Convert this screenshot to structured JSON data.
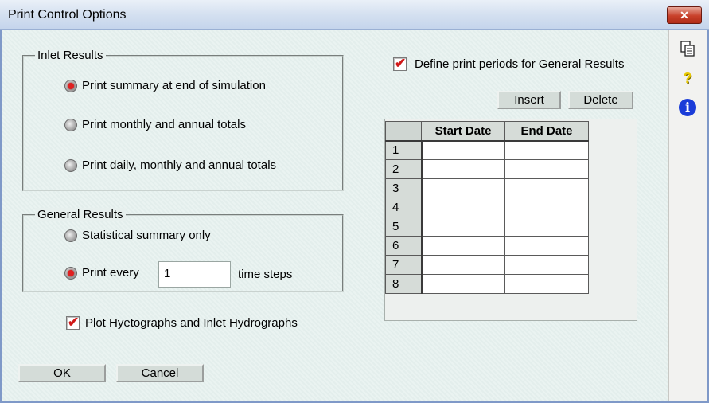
{
  "window": {
    "title": "Print Control Options",
    "close_label": "✕"
  },
  "inlet_results": {
    "title": "Inlet Results",
    "options": [
      {
        "label": "Print summary at end of simulation",
        "selected": true
      },
      {
        "label": "Print monthly and annual totals",
        "selected": false
      },
      {
        "label": "Print daily, monthly and annual totals",
        "selected": false
      }
    ]
  },
  "general_results": {
    "title": "General Results",
    "statistical_label": "Statistical summary only",
    "print_every_label": "Print every",
    "print_every_value": "1",
    "time_steps_label": "time steps"
  },
  "plot_checkbox": {
    "label": "Plot Hyetographs and Inlet  Hydrographs",
    "checked": true
  },
  "define_periods": {
    "label": "Define print periods for General Results",
    "checked": true
  },
  "buttons": {
    "insert": "Insert",
    "delete": "Delete",
    "ok": "OK",
    "cancel": "Cancel"
  },
  "grid": {
    "columns": [
      "Start Date",
      "End Date"
    ],
    "rows": [
      "1",
      "2",
      "3",
      "4",
      "5",
      "6",
      "7",
      "8"
    ]
  },
  "sidebar": {
    "icons": [
      "copy-icon",
      "help-icon",
      "info-icon"
    ],
    "help_glyph": "?",
    "info_glyph": "i"
  },
  "colors": {
    "radio_selected": "#e02020",
    "check": "#d01818",
    "background": "#e7f0ee"
  }
}
